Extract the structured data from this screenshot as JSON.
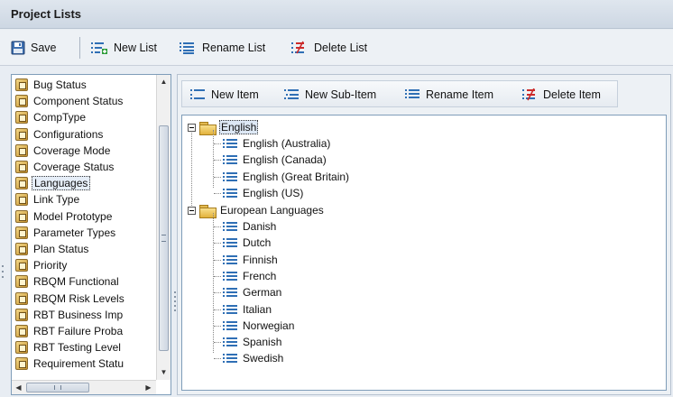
{
  "window": {
    "title": "Project Lists"
  },
  "toolbar": {
    "save_label": "Save",
    "new_list_label": "New List",
    "rename_list_label": "Rename List",
    "delete_list_label": "Delete List"
  },
  "lists": {
    "items": [
      {
        "label": "Bug Status"
      },
      {
        "label": "Component Status"
      },
      {
        "label": "CompType"
      },
      {
        "label": "Configurations"
      },
      {
        "label": "Coverage Mode"
      },
      {
        "label": "Coverage Status"
      },
      {
        "label": "Languages"
      },
      {
        "label": "Link Type"
      },
      {
        "label": "Model Prototype"
      },
      {
        "label": "Parameter Types"
      },
      {
        "label": "Plan Status"
      },
      {
        "label": "Priority"
      },
      {
        "label": "RBQM Functional"
      },
      {
        "label": "RBQM Risk Levels"
      },
      {
        "label": "RBT Business Imp"
      },
      {
        "label": "RBT Failure Proba"
      },
      {
        "label": "RBT Testing Level"
      },
      {
        "label": "Requirement Statu"
      }
    ],
    "selected": "Languages"
  },
  "item_toolbar": {
    "new_item_label": "New Item",
    "new_sub_item_label": "New Sub-Item",
    "rename_item_label": "Rename Item",
    "delete_item_label": "Delete Item"
  },
  "tree": {
    "english": {
      "label": "English",
      "children": [
        "English (Australia)",
        "English (Canada)",
        "English (Great Britain)",
        "English (US)"
      ]
    },
    "european": {
      "label": "European Languages",
      "children": [
        "Danish",
        "Dutch",
        "Finnish",
        "French",
        "German",
        "Italian",
        "Norwegian",
        "Spanish",
        "Swedish"
      ]
    }
  },
  "icons": {
    "save": "floppy-disk-icon",
    "new_list": "new-list-icon",
    "rename_list": "rename-list-icon",
    "delete_list": "delete-list-icon",
    "list_item": "book-icon",
    "folder": "folder-icon",
    "leaf": "list-leaf-icon"
  },
  "colors": {
    "accent_blue": "#2f6fb5",
    "delete_red": "#cc2b2b",
    "new_green": "#2e9d3a",
    "folder_yellow": "#e2b23c"
  }
}
